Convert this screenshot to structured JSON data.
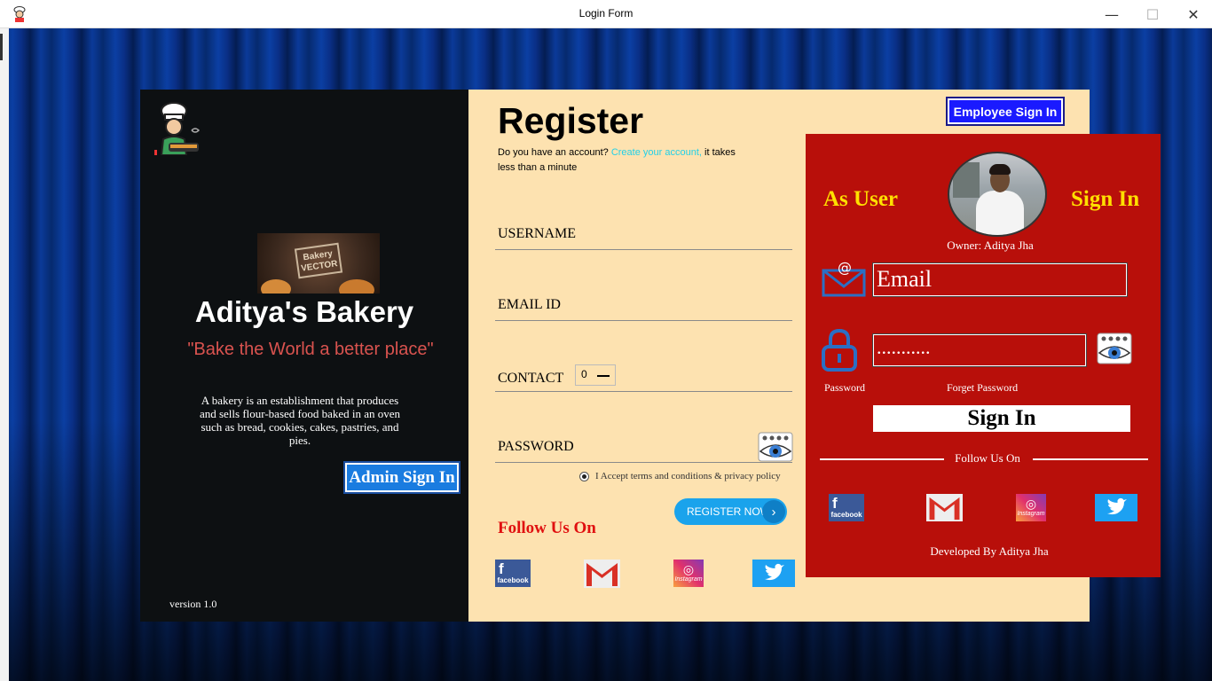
{
  "window": {
    "title": "Login Form",
    "minimize": "—",
    "maximize": "☐",
    "close": "✕"
  },
  "left": {
    "bakery_image_text": "Bakery VECTOR",
    "brand": "Aditya's Bakery",
    "tagline": "\"Bake the World a better place\"",
    "description": "A bakery is an establishment that produces and sells flour-based food baked in an oven such as bread, cookies, cakes, pastries, and pies.",
    "admin_button": "Admin Sign In",
    "version": "version 1.0"
  },
  "register": {
    "title": "Register",
    "sub_prefix": "Do you have an account?",
    "sub_link": "Create your account,",
    "sub_suffix": "it takes less than a minute",
    "employee_button": "Employee Sign In",
    "username_label": "USERNAME",
    "email_label": "EMAIL ID",
    "contact_label": "CONTACT",
    "contact_value": "0",
    "password_label": "PASSWORD",
    "terms": "I Accept terms and conditions & privacy policy",
    "register_button": "REGISTER NOW",
    "register_arrow": "›",
    "follow": "Follow Us On"
  },
  "social": {
    "facebook_text": "facebook",
    "facebook_glyph": "f",
    "instagram_text": "Instagram",
    "instagram_glyph": "◎"
  },
  "signin": {
    "as_user": "As User",
    "sign_in_heading": "Sign In",
    "owner": "Owner: Aditya Jha",
    "email_value": "Email",
    "password_value": "...........",
    "password_label": "Password",
    "forget_password": "Forget Password",
    "sign_in_button": "Sign In",
    "follow": "Follow Us On",
    "developed_by": "Developed By Aditya Jha"
  },
  "colors": {
    "left_panel": "#0d1012",
    "mid_panel": "#fde2b0",
    "red_panel": "#b80f0a",
    "accent_yellow": "#ffe000",
    "link_cyan": "#22d0e8"
  },
  "icons": [
    "chef-icon",
    "mail-icon",
    "lock-icon",
    "eye-icon",
    "facebook-icon",
    "gmail-icon",
    "instagram-icon",
    "twitter-icon"
  ]
}
